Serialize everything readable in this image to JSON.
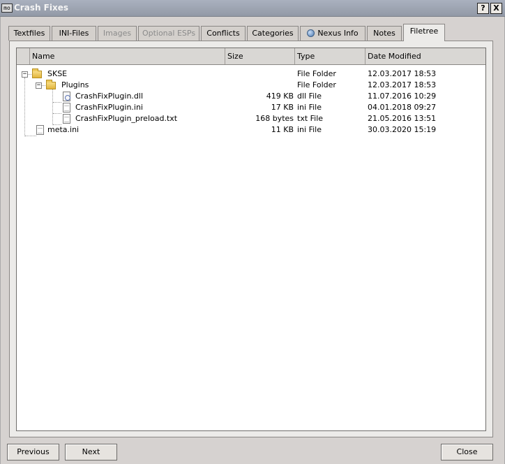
{
  "window": {
    "icon_text": "mo",
    "title": "Crash Fixes",
    "help_label": "?",
    "close_label": "X"
  },
  "tabs": [
    {
      "label": "Textfiles",
      "state": "normal"
    },
    {
      "label": "INI-Files",
      "state": "normal"
    },
    {
      "label": "Images",
      "state": "disabled"
    },
    {
      "label": "Optional ESPs",
      "state": "disabled"
    },
    {
      "label": "Conflicts",
      "state": "normal"
    },
    {
      "label": "Categories",
      "state": "normal"
    },
    {
      "label": "Nexus Info",
      "state": "normal",
      "icon": "globe-icon"
    },
    {
      "label": "Notes",
      "state": "normal"
    },
    {
      "label": "Filetree",
      "state": "active"
    }
  ],
  "filetree": {
    "columns": [
      "Name",
      "Size",
      "Type",
      "Date Modified"
    ],
    "rows": [
      {
        "name": "SKSE",
        "size": "",
        "type": "File Folder",
        "date": "12.03.2017 18:53",
        "icon": "folder-icon",
        "expanded": "−"
      },
      {
        "name": "Plugins",
        "size": "",
        "type": "File Folder",
        "date": "12.03.2017 18:53",
        "icon": "folder-icon",
        "expanded": "−"
      },
      {
        "name": "CrashFixPlugin.dll",
        "size": "419 KB",
        "type": "dll File",
        "date": "11.07.2016 10:29",
        "icon": "dll-file-icon"
      },
      {
        "name": "CrashFixPlugin.ini",
        "size": "17 KB",
        "type": "ini File",
        "date": "04.01.2018 09:27",
        "icon": "text-file-icon"
      },
      {
        "name": "CrashFixPlugin_preload.txt",
        "size": "168 bytes",
        "type": "txt File",
        "date": "21.05.2016 13:51",
        "icon": "text-file-icon"
      },
      {
        "name": "meta.ini",
        "size": "11 KB",
        "type": "ini File",
        "date": "30.03.2020 15:19",
        "icon": "text-file-icon"
      }
    ]
  },
  "buttons": {
    "previous": "Previous",
    "next": "Next",
    "close": "Close"
  }
}
